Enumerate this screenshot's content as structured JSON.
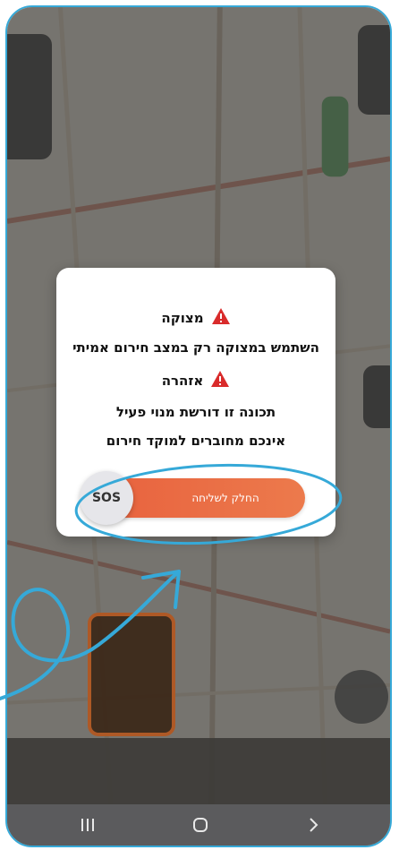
{
  "dialog": {
    "alert_title": "מצוקה",
    "alert_text": "השתמש במצוקה רק במצב חירום אמיתי",
    "warning_title": "אזהרה",
    "warning_text": "תכונה זו דורשת מנוי פעיל",
    "connected_text": "אינכם מחוברים למוקד חירום",
    "slider_label": "החלק לשליחה",
    "sos_label": "SOS"
  },
  "colors": {
    "accent": "#ec6b43",
    "warning_icon": "#d92b2b",
    "annotation": "#36a9d8",
    "nav_bar": "#5b5b5d"
  },
  "navbar": {
    "icons": [
      "recent-apps-icon",
      "home-icon",
      "back-icon"
    ]
  }
}
